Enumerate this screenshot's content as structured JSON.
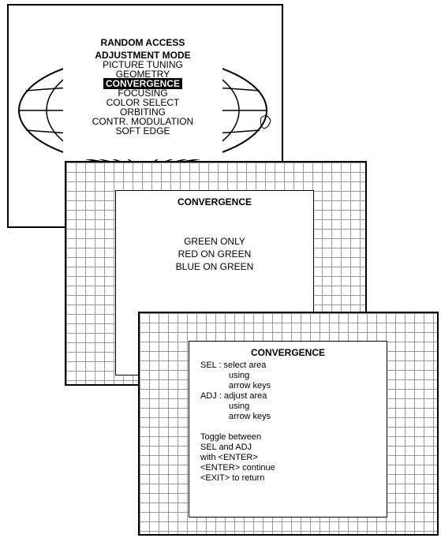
{
  "menu1": {
    "title_line1": "RANDOM ACCESS",
    "title_line2": "ADJUSTMENT MODE",
    "items": [
      "PICTURE TUNING",
      "GEOMETRY",
      "CONVERGENCE",
      "FOCUSING",
      "COLOR SELECT",
      "ORBITING",
      "CONTR. MODULATION",
      "SOFT EDGE"
    ],
    "selected_index": 2
  },
  "menu2": {
    "title": "CONVERGENCE",
    "items": [
      "GREEN ONLY",
      "RED ON GREEN",
      "BLUE ON GREEN"
    ]
  },
  "menu3": {
    "title": "CONVERGENCE",
    "lines": [
      "SEL : select area",
      "using",
      "arrow keys",
      "ADJ : adjust area",
      "using",
      "arrow keys",
      "",
      "Toggle between",
      "SEL and ADJ",
      "with <ENTER>",
      "<ENTER> continue",
      "<EXIT> to return"
    ]
  }
}
